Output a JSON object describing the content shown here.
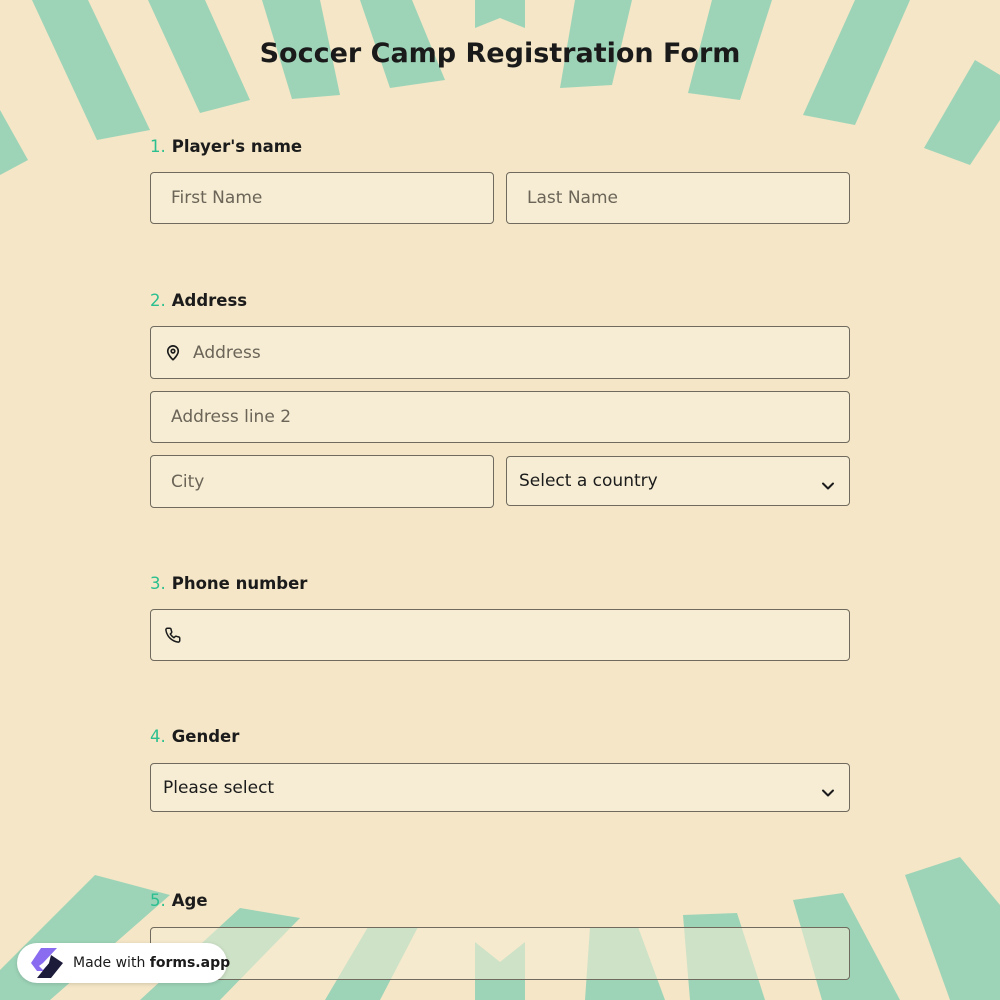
{
  "form": {
    "title": "Soccer Camp Registration Form"
  },
  "questions": [
    {
      "number": "1.",
      "label": "Player's name",
      "fields": {
        "first_name_placeholder": "First Name",
        "last_name_placeholder": "Last Name"
      }
    },
    {
      "number": "2.",
      "label": "Address",
      "fields": {
        "address_placeholder": "Address",
        "address2_placeholder": "Address line 2",
        "city_placeholder": "City",
        "country_selected": "Select a country"
      }
    },
    {
      "number": "3.",
      "label": "Phone number",
      "fields": {
        "phone_value": ""
      }
    },
    {
      "number": "4.",
      "label": "Gender",
      "fields": {
        "gender_selected": "Please select"
      }
    },
    {
      "number": "5.",
      "label": "Age",
      "fields": {
        "age_value": ""
      }
    }
  ],
  "badge": {
    "prefix": "Made with",
    "brand": "forms.app"
  },
  "icons": {
    "address": "map-pin-icon",
    "phone": "phone-icon",
    "dropdown": "chevron-down-icon",
    "brand": "forms-app-logo"
  },
  "colors": {
    "background": "#f4e6c6",
    "decor": "#9dd4b8",
    "field_bg": "#f6edd4",
    "accent_number": "#2bbf8f",
    "border": "#6f6a5d"
  }
}
